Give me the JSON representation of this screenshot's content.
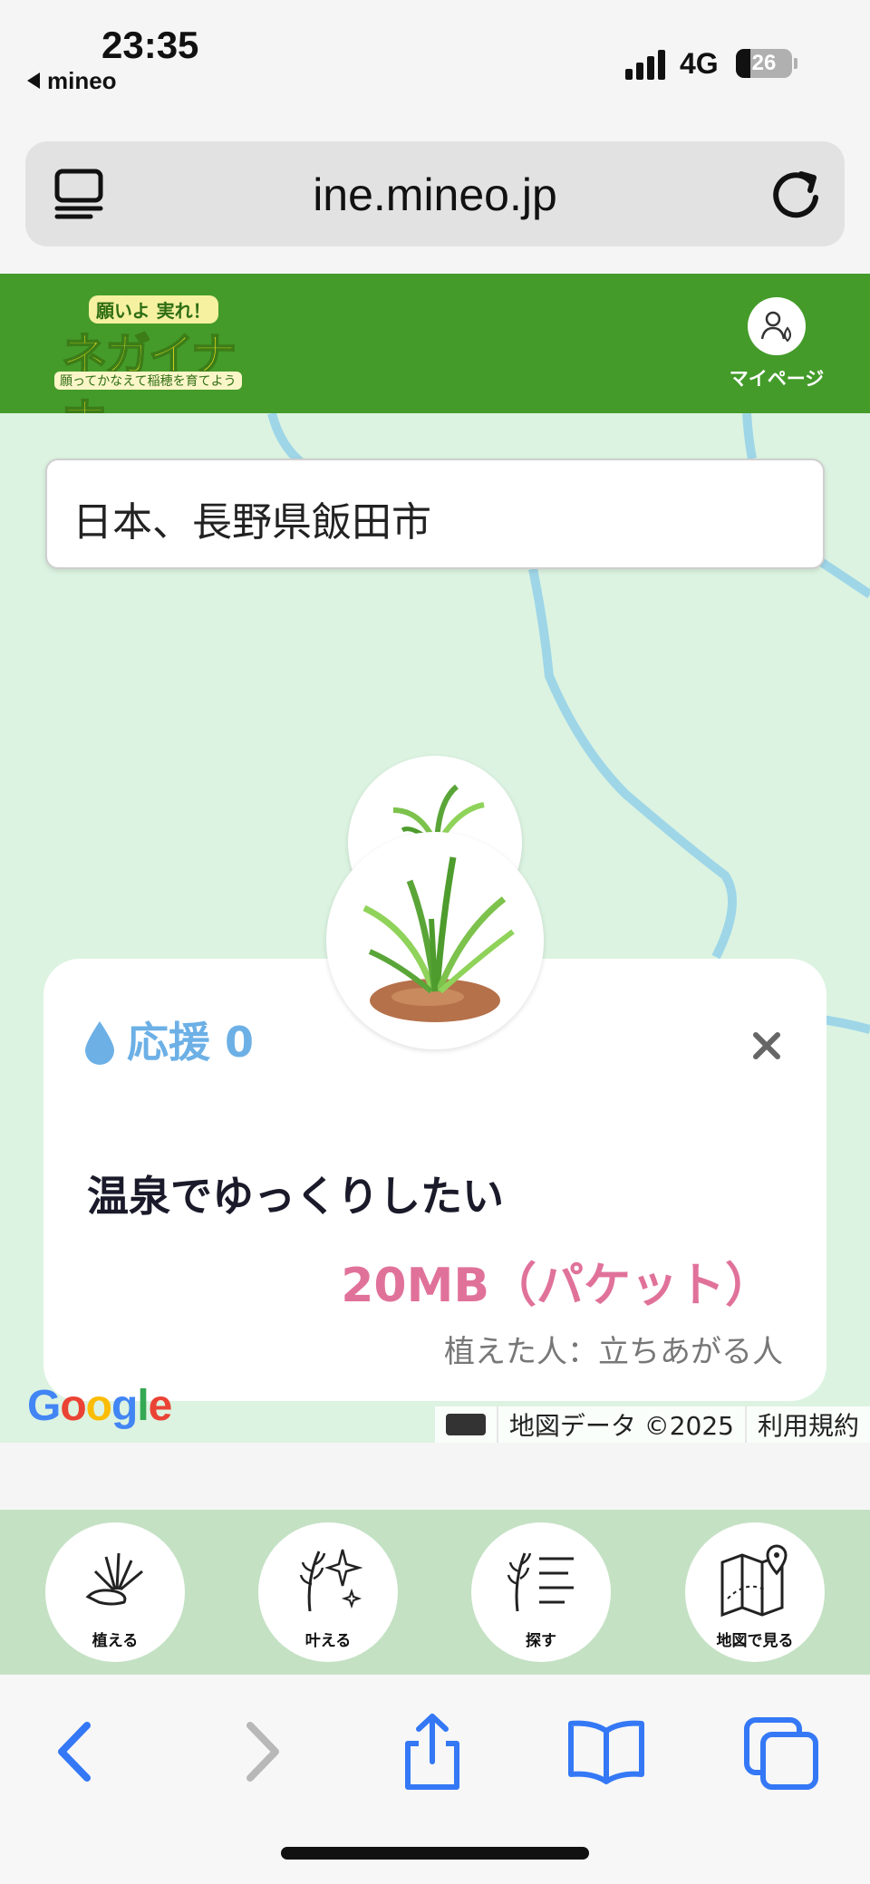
{
  "status_bar": {
    "time": "23:35",
    "back_app": "mineo",
    "network": "4G",
    "battery": "26"
  },
  "browser": {
    "url": "ine.mineo.jp",
    "tabs_icon": "tab-overview-icon",
    "reload_icon": "reload-icon"
  },
  "header": {
    "logo_top": "願いよ 実れ！",
    "logo_main": "ネガイナホ",
    "logo_sub": "願ってかなえて稲穂を育てよう",
    "mypage_label": "マイページ"
  },
  "map": {
    "search_value": "日本、長野県飯田市",
    "google": [
      "G",
      "o",
      "o",
      "g",
      "l",
      "e"
    ],
    "map_data": "地図データ ©2025",
    "terms": "利用規約"
  },
  "card": {
    "support_label": "応援",
    "support_count": "0",
    "wish": "温泉でゆっくりしたい",
    "reward": "20MB（パケット）",
    "planter": "植えた人：立ちあがる人",
    "close_symbol": "×"
  },
  "toolbar": {
    "plant": "植える",
    "grant": "叶える",
    "search": "探す",
    "map": "地図で見る"
  },
  "colors": {
    "header_green": "#449b2a",
    "map_bg": "#dcf3e1",
    "river": "#9ed6e8",
    "support_blue": "#6cb0e6",
    "reward_pink": "#e0729a",
    "toolbar_bg": "#c4e1c4",
    "browser_blue": "#3478f6"
  }
}
